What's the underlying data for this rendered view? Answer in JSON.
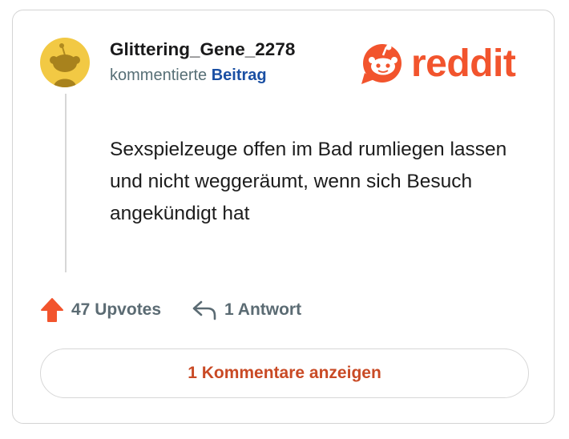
{
  "post": {
    "username": "Glittering_Gene_2278",
    "action_text": "kommentierte",
    "action_link": "Beitrag",
    "body": "Sexspielzeuge offen im Bad rumliegen lassen und nicht weggeräumt, wenn sich Besuch angekündigt hat"
  },
  "brand": {
    "logo_text": "reddit",
    "color": "#f2542d"
  },
  "actions": {
    "upvotes_label": "47 Upvotes",
    "replies_label": "1 Antwort"
  },
  "comments_button_label": "1 Kommentare anzeigen",
  "colors": {
    "avatar_bg": "#f2c944",
    "link": "#1a4fa3",
    "upvote": "#f2542d",
    "button_text": "#c94a25"
  },
  "icons": {
    "avatar": "snoo-avatar-icon",
    "logo": "reddit-snoo-icon",
    "upvote": "upvote-arrow-icon",
    "reply": "reply-arrow-icon"
  }
}
